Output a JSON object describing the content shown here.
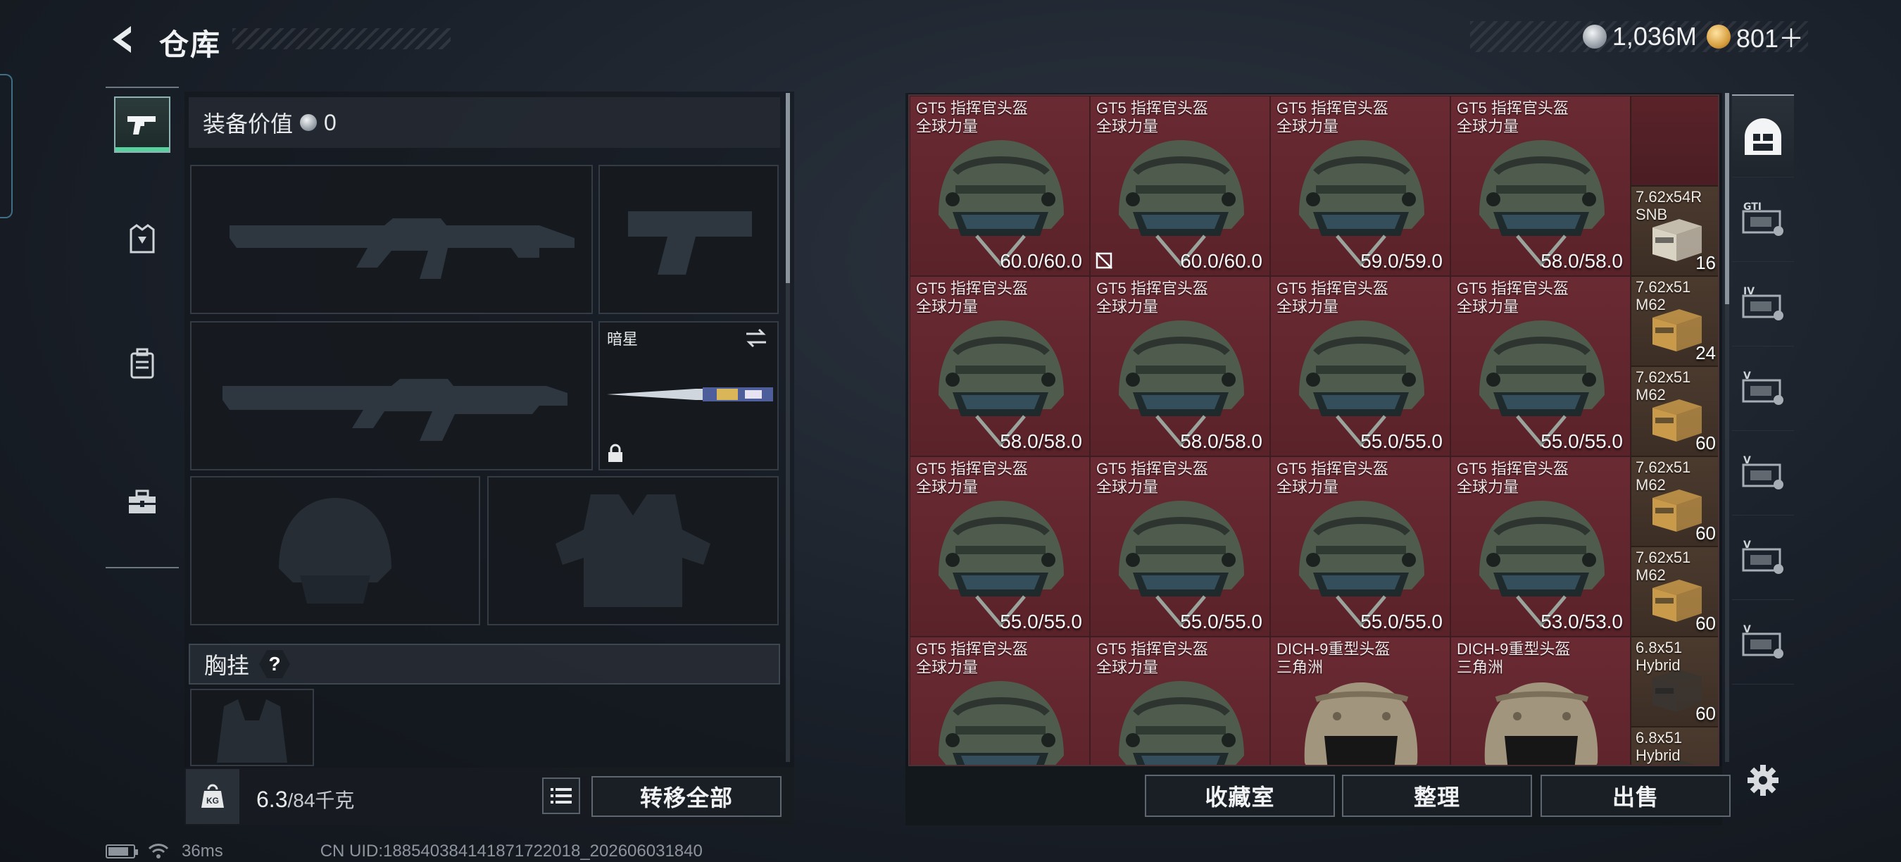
{
  "header": {
    "title": "仓库",
    "currency": [
      {
        "icon": "silver-coin-icon",
        "value": "1,036M"
      },
      {
        "icon": "gold-coin-icon",
        "value": "801＋"
      }
    ]
  },
  "nav": {
    "items": [
      {
        "name": "weapons",
        "icon": "pistol-icon",
        "active": true
      },
      {
        "name": "armor",
        "icon": "armor-icon",
        "active": false
      },
      {
        "name": "backpack",
        "icon": "backpack-icon",
        "active": false
      },
      {
        "name": "toolbox",
        "icon": "toolbox-icon",
        "active": false
      }
    ]
  },
  "loadout": {
    "equip_value_label": "装备价值",
    "equip_value": "0",
    "melee_slot": {
      "label": "暗星",
      "locked": true
    },
    "chest_rig_label": "胸挂",
    "chest_rig_help": "?",
    "weight_current": "6.3",
    "weight_max": "/84千克",
    "weight_icon_label": "KG",
    "transfer_all_label": "转移全部"
  },
  "stash": {
    "helmets": [
      {
        "name1": "GT5 指挥官头盔",
        "name2": "全球力量",
        "durability": "60.0/60.0",
        "type": "gt5",
        "unrepairable": false
      },
      {
        "name1": "GT5 指挥官头盔",
        "name2": "全球力量",
        "durability": "60.0/60.0",
        "type": "gt5",
        "unrepairable": true
      },
      {
        "name1": "GT5 指挥官头盔",
        "name2": "全球力量",
        "durability": "59.0/59.0",
        "type": "gt5",
        "unrepairable": false
      },
      {
        "name1": "GT5 指挥官头盔",
        "name2": "全球力量",
        "durability": "58.0/58.0",
        "type": "gt5",
        "unrepairable": false
      },
      {
        "name1": "GT5 指挥官头盔",
        "name2": "全球力量",
        "durability": "58.0/58.0",
        "type": "gt5",
        "unrepairable": false
      },
      {
        "name1": "GT5 指挥官头盔",
        "name2": "全球力量",
        "durability": "58.0/58.0",
        "type": "gt5",
        "unrepairable": false
      },
      {
        "name1": "GT5 指挥官头盔",
        "name2": "全球力量",
        "durability": "55.0/55.0",
        "type": "gt5",
        "unrepairable": false
      },
      {
        "name1": "GT5 指挥官头盔",
        "name2": "全球力量",
        "durability": "55.0/55.0",
        "type": "gt5",
        "unrepairable": false
      },
      {
        "name1": "GT5 指挥官头盔",
        "name2": "全球力量",
        "durability": "55.0/55.0",
        "type": "gt5",
        "unrepairable": false
      },
      {
        "name1": "GT5 指挥官头盔",
        "name2": "全球力量",
        "durability": "55.0/55.0",
        "type": "gt5",
        "unrepairable": false
      },
      {
        "name1": "GT5 指挥官头盔",
        "name2": "全球力量",
        "durability": "55.0/55.0",
        "type": "gt5",
        "unrepairable": false
      },
      {
        "name1": "GT5 指挥官头盔",
        "name2": "全球力量",
        "durability": "53.0/53.0",
        "type": "gt5",
        "unrepairable": false
      },
      {
        "name1": "GT5 指挥官头盔",
        "name2": "全球力量",
        "durability": "",
        "type": "gt5",
        "unrepairable": false
      },
      {
        "name1": "GT5 指挥官头盔",
        "name2": "全球力量",
        "durability": "",
        "type": "gt5",
        "unrepairable": false
      },
      {
        "name1": "DICH-9重型头盔",
        "name2": "三角洲",
        "durability": "",
        "type": "dich",
        "unrepairable": false
      },
      {
        "name1": "DICH-9重型头盔",
        "name2": "三角洲",
        "durability": "",
        "type": "dich",
        "unrepairable": false
      }
    ],
    "ammo": [
      {
        "name1": "",
        "name2": "",
        "count": "",
        "empty": true
      },
      {
        "name1": "7.62x54R",
        "name2": "SNB",
        "count": "16",
        "color": "#d9d3c3"
      },
      {
        "name1": "7.62x51",
        "name2": "M62",
        "count": "24",
        "color": "#c99a4a"
      },
      {
        "name1": "7.62x51",
        "name2": "M62",
        "count": "60",
        "color": "#c99a4a"
      },
      {
        "name1": "7.62x51",
        "name2": "M62",
        "count": "60",
        "color": "#c99a4a"
      },
      {
        "name1": "7.62x51",
        "name2": "M62",
        "count": "60",
        "color": "#c99a4a"
      },
      {
        "name1": "6.8x51",
        "name2": "Hybrid",
        "count": "60",
        "color": "#3a3530"
      },
      {
        "name1": "6.8x51",
        "name2": "Hybrid",
        "count": "",
        "color": "#3a3530"
      }
    ]
  },
  "actions": {
    "collection_label": "收藏室",
    "organize_label": "整理",
    "sell_label": "出售"
  },
  "right_tabs": [
    {
      "icon": "stash-home-icon",
      "label": "",
      "active": true
    },
    {
      "icon": "case-gti-icon",
      "label": "GTI",
      "active": false
    },
    {
      "icon": "case-iv-icon",
      "label": "IV",
      "active": false
    },
    {
      "icon": "case-v-icon",
      "label": "V",
      "active": false
    },
    {
      "icon": "case-v-icon",
      "label": "V",
      "active": false
    },
    {
      "icon": "case-v-icon",
      "label": "V",
      "active": false
    },
    {
      "icon": "case-v-icon",
      "label": "V",
      "active": false
    }
  ],
  "footer": {
    "ping": "36ms",
    "uid": "CN UID:18854038414187172201​8_202606031840"
  }
}
